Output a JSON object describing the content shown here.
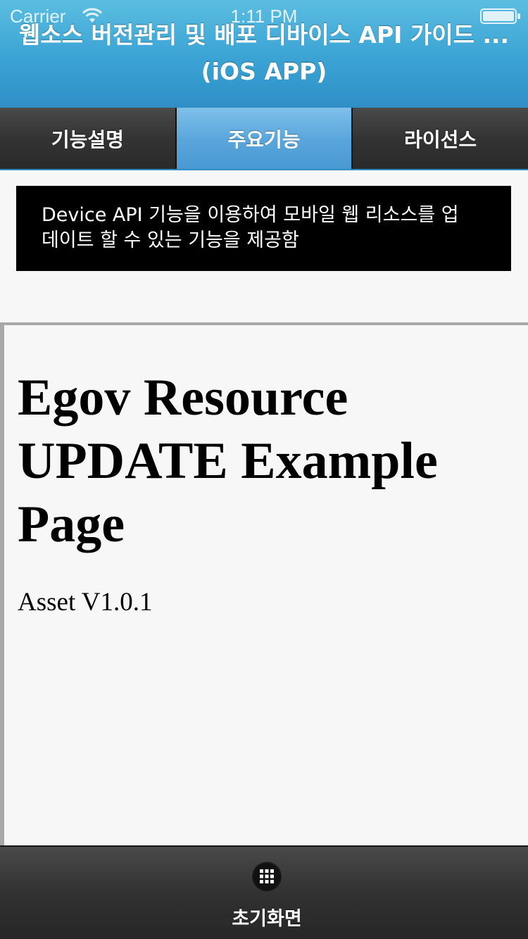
{
  "status_bar": {
    "carrier": "Carrier",
    "time": "1:11 PM",
    "wifi_icon": "wifi-icon",
    "battery_icon": "battery-icon"
  },
  "header": {
    "title_line1": "웹소스 버전관리 및 배포 디바이스 API 가이드 ...",
    "title_line2": "(iOS APP)",
    "background_color": "#3aa3d4"
  },
  "tabs": [
    {
      "label": "기능설명",
      "active": false
    },
    {
      "label": "주요기능",
      "active": true
    },
    {
      "label": "라이선스",
      "active": false
    }
  ],
  "description": {
    "line1": "Device API 기능을 이용하여 모바일 웹 리소스를 업",
    "line2": "데이트 할 수 있는 기능을 제공함"
  },
  "web_content": {
    "heading_line1": "Egov Resource",
    "heading_line2": "UPDATE Example",
    "heading_line3": "Page",
    "version_text": "Asset V1.0.1"
  },
  "bottom_bar": {
    "home_icon": "grid-icon",
    "home_label": "초기화면"
  }
}
